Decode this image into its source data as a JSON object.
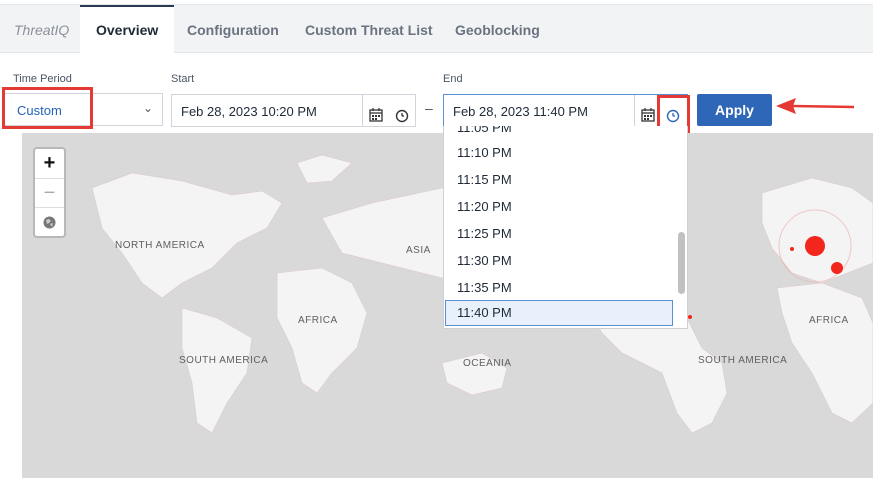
{
  "tabs": {
    "brand": "ThreatIQ",
    "overview": "Overview",
    "configuration": "Configuration",
    "custom_threat_list": "Custom Threat List",
    "geoblocking": "Geoblocking"
  },
  "filters": {
    "time_period_label": "Time Period",
    "time_period_value": "Custom",
    "start_label": "Start",
    "start_value": "Feb 28, 2023 10:20 PM",
    "end_label": "End",
    "end_value": "Feb 28, 2023 11:40 PM",
    "separator": "–",
    "apply_label": "Apply"
  },
  "time_options": [
    "11:05 PM",
    "11:10 PM",
    "11:15 PM",
    "11:20 PM",
    "11:25 PM",
    "11:30 PM",
    "11:35 PM",
    "11:40 PM"
  ],
  "selected_time": "11:40 PM",
  "map": {
    "zoom_in": "+",
    "zoom_out": "−",
    "labels": {
      "north_america": "NORTH AMERICA",
      "asia": "ASIA",
      "africa_left": "AFRICA",
      "south_america_left": "SOUTH AMERICA",
      "oceania": "OCEANIA",
      "south_america_right": "SOUTH AMERICA",
      "africa_right": "AFRICA"
    }
  },
  "colors": {
    "accent": "#2f67b8",
    "highlight": "#e53935",
    "threat_dot": "#f2261d"
  }
}
